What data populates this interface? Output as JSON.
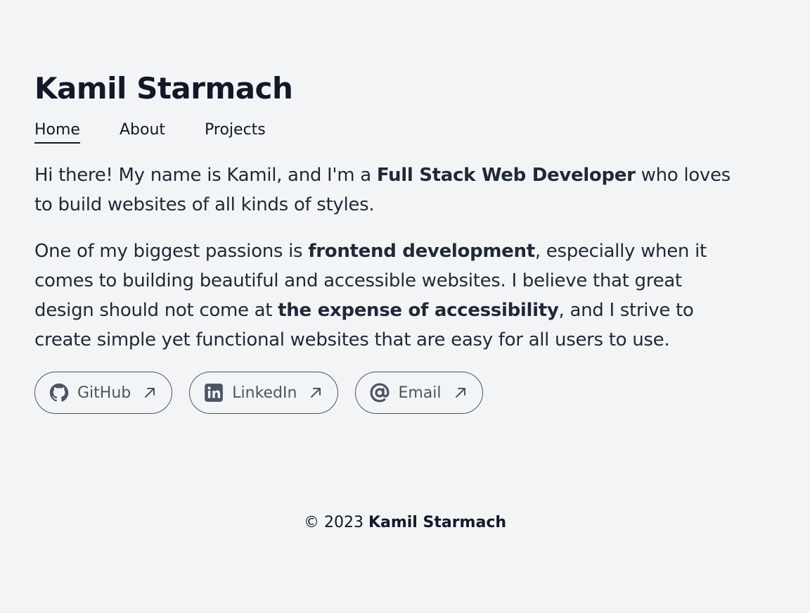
{
  "header": {
    "title": "Kamil Starmach"
  },
  "nav": {
    "items": [
      {
        "label": "Home",
        "active": true
      },
      {
        "label": "About",
        "active": false
      },
      {
        "label": "Projects",
        "active": false
      }
    ]
  },
  "intro": {
    "p1_a": "Hi there! My name is Kamil, and I'm a ",
    "p1_b": "Full Stack Web Developer",
    "p1_c": " who loves to build websites of all kinds of styles.",
    "p2_a": "One of my biggest passions is ",
    "p2_b": "frontend development",
    "p2_c": ", especially when it comes to building beautiful and accessible websites. I believe that great design should not come at ",
    "p2_d": "the expense of accessibility",
    "p2_e": ", and I strive to create simple yet functional websites that are easy for all users to use."
  },
  "links": [
    {
      "label": "GitHub",
      "icon": "github-icon"
    },
    {
      "label": "LinkedIn",
      "icon": "linkedin-icon"
    },
    {
      "label": "Email",
      "icon": "at-sign-icon"
    }
  ],
  "footer": {
    "copyright": "© 2023 ",
    "name": "Kamil Starmach"
  },
  "colors": {
    "background": "#f3f4f6",
    "text": "#1f2937",
    "heading": "#111827",
    "pill": "#4b5563"
  }
}
